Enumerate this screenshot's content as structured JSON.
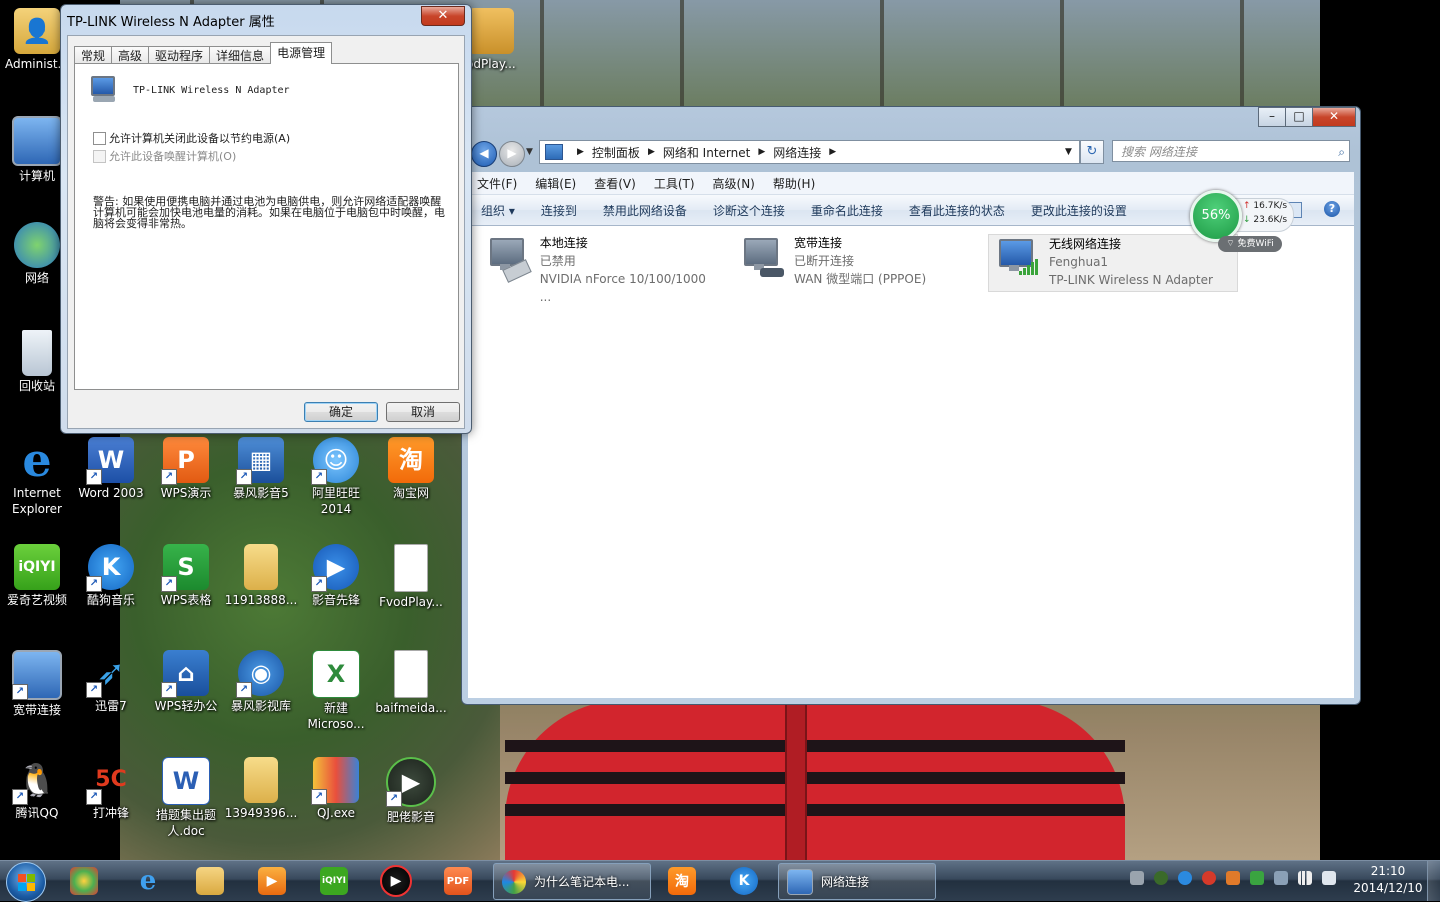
{
  "dialog": {
    "title": "TP-LINK Wireless N Adapter 属性",
    "close_label": "✕",
    "tabs": [
      "常规",
      "高级",
      "驱动程序",
      "详细信息",
      "电源管理"
    ],
    "active_tab": "电源管理",
    "adapter_name": "TP-LINK Wireless N Adapter",
    "checkbox_allow_off": "允许计算机关闭此设备以节约电源(A)",
    "checkbox_allow_wake": "允许此设备唤醒计算机(O)",
    "warning_text": "警告: 如果使用便携电脑并通过电池为电脑供电，则允许网络适配器唤醒计算机可能会加快电池电量的消耗。如果在电脑位于电脑包中时唤醒，电脑将会变得非常热。",
    "ok_label": "确定",
    "cancel_label": "取消"
  },
  "explorer": {
    "window_buttons": {
      "minimize": "–",
      "maximize": "□",
      "close": "✕"
    },
    "breadcrumb": [
      "控制面板",
      "网络和 Internet",
      "网络连接"
    ],
    "search_placeholder": "搜索 网络连接",
    "menu": [
      "文件(F)",
      "编辑(E)",
      "查看(V)",
      "工具(T)",
      "高级(N)",
      "帮助(H)"
    ],
    "commands": [
      "组织 ▾",
      "连接到",
      "禁用此网络设备",
      "诊断这个连接",
      "重命名此连接",
      "查看此连接的状态",
      "更改此连接的设置"
    ],
    "help_icon": "?",
    "connections": [
      {
        "name": "本地连接",
        "status": "已禁用",
        "device": "NVIDIA nForce 10/100/1000 ..."
      },
      {
        "name": "宽带连接",
        "status": "已断开连接",
        "device": "WAN 微型端口 (PPPOE)"
      },
      {
        "name": "无线网络连接",
        "status": "Fenghua1",
        "device": "TP-LINK Wireless N Adapter"
      }
    ]
  },
  "speed_widget": {
    "percent": "56%",
    "upload": "16.7K/s",
    "download": "23.6K/s",
    "wifi_label": "免费WiFi"
  },
  "desktop_icons": [
    {
      "label": "Administ..."
    },
    {
      "label": "计算机"
    },
    {
      "label": "网络"
    },
    {
      "label": "回收站"
    },
    {
      "label": "Internet Explorer"
    },
    {
      "label": "Word 2003"
    },
    {
      "label": "WPS演示"
    },
    {
      "label": "暴风影音5"
    },
    {
      "label": "阿里旺旺 2014"
    },
    {
      "label": "淘宝网"
    },
    {
      "label": "爱奇艺视频"
    },
    {
      "label": "酷狗音乐"
    },
    {
      "label": "WPS表格"
    },
    {
      "label": "11913888..."
    },
    {
      "label": "影音先锋"
    },
    {
      "label": "FvodPlay..."
    },
    {
      "label": "宽带连接"
    },
    {
      "label": "迅雷7"
    },
    {
      "label": "WPS轻办公"
    },
    {
      "label": "暴风影视库"
    },
    {
      "label": "新建 Microso..."
    },
    {
      "label": "baifmeida..."
    },
    {
      "label": "腾讯QQ"
    },
    {
      "label": "打冲锋"
    },
    {
      "label": "措题集出题人.doc"
    },
    {
      "label": "13949396..."
    },
    {
      "label": "QJ.exe"
    },
    {
      "label": "肥佬影音"
    },
    {
      "label": "odPlay..."
    }
  ],
  "taskbar": {
    "tasks": [
      {
        "label": "为什么笔记本电..."
      },
      {
        "label": "网络连接"
      }
    ],
    "clock_time": "21:10",
    "clock_date": "2014/12/10"
  }
}
